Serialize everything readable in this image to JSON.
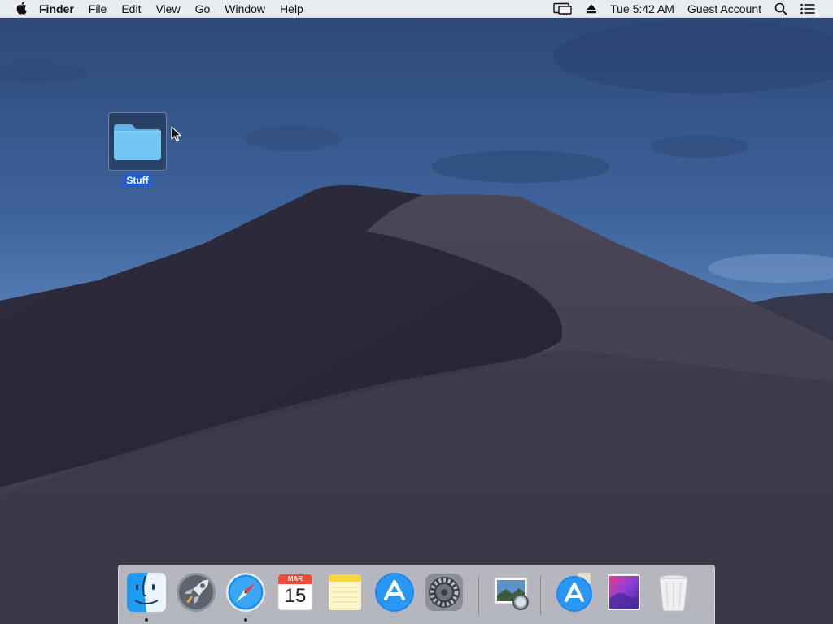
{
  "menubar": {
    "app_name": "Finder",
    "menus": [
      "File",
      "Edit",
      "View",
      "Go",
      "Window",
      "Help"
    ],
    "clock": "Tue 5:42 AM",
    "user": "Guest Account"
  },
  "desktop": {
    "items": [
      {
        "label": "Stuff",
        "icon": "folder-icon",
        "selected": true
      }
    ]
  },
  "dock": {
    "apps": [
      {
        "name": "Finder",
        "icon": "finder-icon",
        "running": true
      },
      {
        "name": "Launchpad",
        "icon": "launchpad-icon",
        "running": false
      },
      {
        "name": "Safari",
        "icon": "safari-icon",
        "running": true
      },
      {
        "name": "Calendar",
        "icon": "calendar-icon",
        "running": false,
        "month": "MAR",
        "day": "15"
      },
      {
        "name": "Notes",
        "icon": "notes-icon",
        "running": false
      },
      {
        "name": "App Store",
        "icon": "app-store-icon",
        "running": false
      },
      {
        "name": "System Preferences",
        "icon": "gear-icon",
        "running": false
      }
    ],
    "others": [
      {
        "name": "Preview",
        "icon": "preview-icon"
      },
      {
        "name": "Downloads",
        "icon": "app-store-download-icon"
      },
      {
        "name": "macOS Installer",
        "icon": "installer-icon"
      },
      {
        "name": "Trash",
        "icon": "trash-icon"
      }
    ]
  },
  "colors": {
    "selection": "#1f5fd3",
    "menubar": "#f0f1f4",
    "sky_top": "#2d4a78",
    "sky_bottom": "#5f86b8",
    "dune": "#3a3645"
  }
}
